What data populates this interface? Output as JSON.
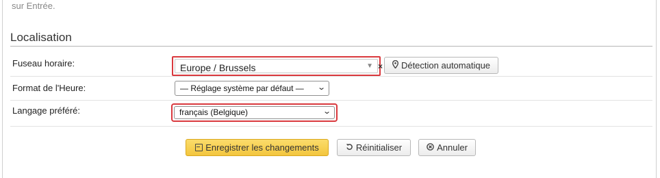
{
  "previous_hint": "sur Entrée.",
  "section": {
    "title": "Localisation"
  },
  "timezone": {
    "label": "Fuseau horaire:",
    "value": "Europe / Brussels",
    "clear_glyph": "×",
    "auto_detect_label": "Détection automatique"
  },
  "time_format": {
    "label": "Format de l'Heure:",
    "value": "— Réglage système par défaut —"
  },
  "language": {
    "label": "Langage préféré:",
    "value": "français (Belgique)"
  },
  "actions": {
    "save_label": "Enregistrer les changements",
    "reset_label": "Réinitialiser",
    "cancel_label": "Annuler"
  },
  "icons": {
    "auto_detect": "map-marker-icon",
    "save": "floppy-disk-icon",
    "reset": "undo-icon",
    "cancel": "cancel-circle-icon"
  },
  "colors": {
    "highlight_border": "#d9383d",
    "save_button": "#f3c63e"
  }
}
